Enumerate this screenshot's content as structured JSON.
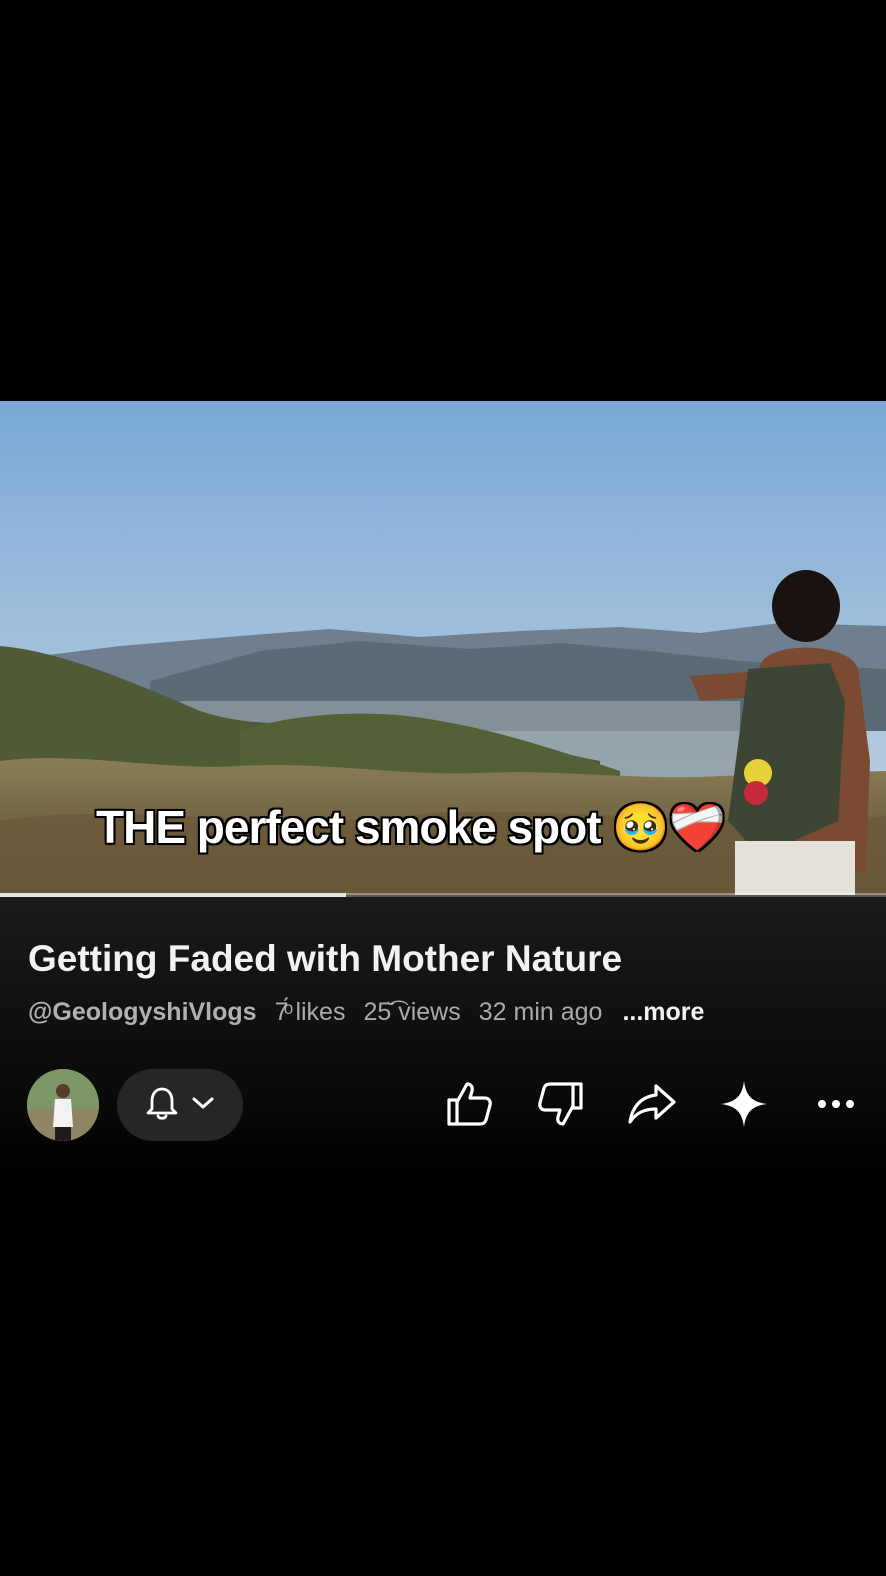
{
  "video": {
    "caption": "THE perfect smoke spot 🥹❤️‍🩹",
    "progress": 0.39
  },
  "details": {
    "title": "Getting Faded with Mother Nature",
    "channel_handle": "@GeologyshiVlogs",
    "likes_value": "7́ͦ",
    "likes_label": "likes",
    "views_value": "25̆͡",
    "views_label": "views",
    "age": "32 min ago",
    "more_label": "...more"
  },
  "actions": {
    "icons": [
      "avatar",
      "bell-icon",
      "chevron-down-icon",
      "thumbs-up-icon",
      "thumbs-down-icon",
      "share-icon",
      "sparkle-icon",
      "more-icon"
    ]
  }
}
